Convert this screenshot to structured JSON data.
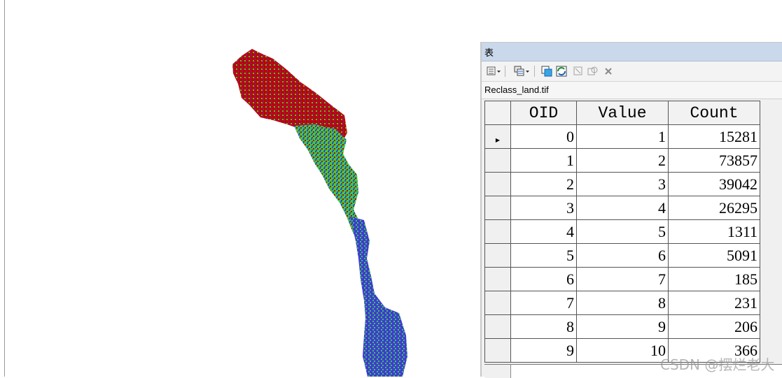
{
  "window": {
    "title": "表"
  },
  "toolbar": {
    "icons": [
      "table-options-icon",
      "related-tables-icon",
      "select-by-attributes-icon",
      "switch-selection-icon",
      "clear-selection-icon",
      "zoom-to-selected-icon",
      "delete-selected-icon"
    ]
  },
  "table": {
    "name": "Reclass_land.tif",
    "columns": [
      "OID",
      "Value",
      "Count"
    ],
    "rows": [
      {
        "oid": "0",
        "value": "1",
        "count": "15281"
      },
      {
        "oid": "1",
        "value": "2",
        "count": "73857"
      },
      {
        "oid": "2",
        "value": "3",
        "count": "39042"
      },
      {
        "oid": "3",
        "value": "4",
        "count": "26295"
      },
      {
        "oid": "4",
        "value": "5",
        "count": "1311"
      },
      {
        "oid": "5",
        "value": "6",
        "count": "5091"
      },
      {
        "oid": "6",
        "value": "7",
        "count": "185"
      },
      {
        "oid": "7",
        "value": "8",
        "count": "231"
      },
      {
        "oid": "8",
        "value": "9",
        "count": "206"
      },
      {
        "oid": "9",
        "value": "10",
        "count": "366"
      }
    ]
  },
  "map": {
    "colors": {
      "red": "#c00000",
      "green": "#3ccc3c",
      "blue": "#3c3cdc",
      "purple": "#8a1a8a"
    }
  },
  "watermark": "CSDN @摆烂老大"
}
